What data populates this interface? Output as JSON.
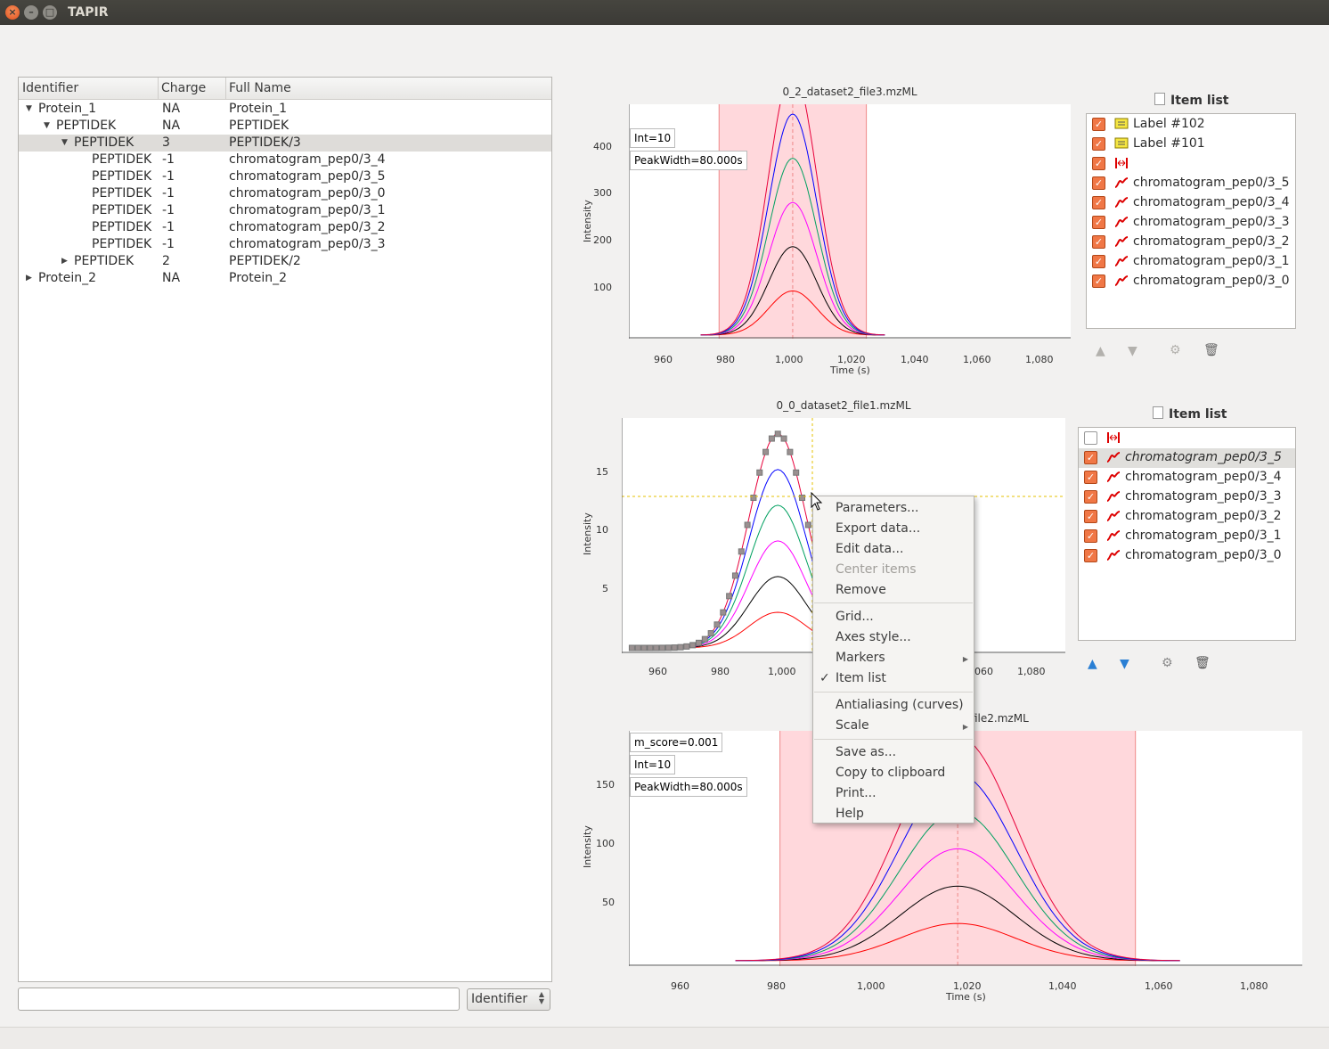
{
  "window": {
    "title": "TAPIR"
  },
  "tree": {
    "columns": [
      "Identifier",
      "Charge",
      "Full Name"
    ],
    "rows": [
      {
        "id": "Protein_1",
        "charge": "NA",
        "name": "Protein_1"
      },
      {
        "id": "PEPTIDEK",
        "charge": "NA",
        "name": "PEPTIDEK"
      },
      {
        "id": "PEPTIDEK",
        "charge": "3",
        "name": "PEPTIDEK/3"
      },
      {
        "id": "PEPTIDEK",
        "charge": "-1",
        "name": "chromatogram_pep0/3_4"
      },
      {
        "id": "PEPTIDEK",
        "charge": "-1",
        "name": "chromatogram_pep0/3_5"
      },
      {
        "id": "PEPTIDEK",
        "charge": "-1",
        "name": "chromatogram_pep0/3_0"
      },
      {
        "id": "PEPTIDEK",
        "charge": "-1",
        "name": "chromatogram_pep0/3_1"
      },
      {
        "id": "PEPTIDEK",
        "charge": "-1",
        "name": "chromatogram_pep0/3_2"
      },
      {
        "id": "PEPTIDEK",
        "charge": "-1",
        "name": "chromatogram_pep0/3_3"
      },
      {
        "id": "PEPTIDEK",
        "charge": "2",
        "name": "PEPTIDEK/2"
      },
      {
        "id": "Protein_2",
        "charge": "NA",
        "name": "Protein_2"
      }
    ]
  },
  "search": {
    "value": "",
    "field": "Identifier"
  },
  "plots": [
    {
      "title": "0_2_dataset2_file3.mzML",
      "xlabel": "Time (s)",
      "ylabel": "Intensity",
      "xticks": [
        "960",
        "980",
        "1,000",
        "1,020",
        "1,040",
        "1,060",
        "1,080"
      ],
      "yticks": [
        "100",
        "200",
        "300",
        "400"
      ],
      "labels": [
        "Int=10",
        "PeakWidth=80.000s"
      ]
    },
    {
      "title": "0_0_dataset2_file1.mzML",
      "xlabel": "",
      "ylabel": "Intensity",
      "xticks": [
        "960",
        "980",
        "1,000",
        "060",
        "1,080"
      ],
      "yticks": [
        "5",
        "10",
        "15"
      ],
      "labels": []
    },
    {
      "title": "file2.mzML",
      "xlabel": "Time (s)",
      "ylabel": "Intensity",
      "xticks": [
        "960",
        "980",
        "1,000",
        "1,020",
        "1,040",
        "1,060",
        "1,080"
      ],
      "yticks": [
        "50",
        "100",
        "150"
      ],
      "labels": [
        "m_score=0.001",
        "Int=10",
        "PeakWidth=80.000s"
      ]
    }
  ],
  "item_lists": [
    {
      "header": "Item list",
      "items": [
        {
          "label": "Label #102",
          "icon": "label-icon",
          "checked": true
        },
        {
          "label": "Label #101",
          "icon": "label-icon",
          "checked": true
        },
        {
          "label": "",
          "icon": "range-icon",
          "checked": true
        },
        {
          "label": "chromatogram_pep0/3_5",
          "icon": "curve-icon",
          "checked": true
        },
        {
          "label": "chromatogram_pep0/3_4",
          "icon": "curve-icon",
          "checked": true
        },
        {
          "label": "chromatogram_pep0/3_3",
          "icon": "curve-icon",
          "checked": true
        },
        {
          "label": "chromatogram_pep0/3_2",
          "icon": "curve-icon",
          "checked": true
        },
        {
          "label": "chromatogram_pep0/3_1",
          "icon": "curve-icon",
          "checked": true
        },
        {
          "label": "chromatogram_pep0/3_0",
          "icon": "curve-icon",
          "checked": true
        }
      ]
    },
    {
      "header": "Item list",
      "items": [
        {
          "label": "",
          "icon": "range-icon",
          "checked": false
        },
        {
          "label": "chromatogram_pep0/3_5",
          "icon": "curve-icon",
          "checked": true
        },
        {
          "label": "chromatogram_pep0/3_4",
          "icon": "curve-icon",
          "checked": true
        },
        {
          "label": "chromatogram_pep0/3_3",
          "icon": "curve-icon",
          "checked": true
        },
        {
          "label": "chromatogram_pep0/3_2",
          "icon": "curve-icon",
          "checked": true
        },
        {
          "label": "chromatogram_pep0/3_1",
          "icon": "curve-icon",
          "checked": true
        },
        {
          "label": "chromatogram_pep0/3_0",
          "icon": "curve-icon",
          "checked": true
        }
      ]
    }
  ],
  "context_menu": {
    "items": [
      {
        "label": "Parameters..."
      },
      {
        "label": "Export data..."
      },
      {
        "label": "Edit data..."
      },
      {
        "label": "Center items",
        "disabled": true
      },
      {
        "label": "Remove"
      },
      {
        "label": "Grid..."
      },
      {
        "label": "Axes style..."
      },
      {
        "label": "Markers",
        "submenu": true
      },
      {
        "label": "Item list",
        "checked": true
      },
      {
        "label": "Antialiasing (curves)"
      },
      {
        "label": "Scale",
        "submenu": true
      },
      {
        "label": "Save as..."
      },
      {
        "label": "Copy to clipboard"
      },
      {
        "label": "Print..."
      },
      {
        "label": "Help"
      }
    ]
  },
  "colors": {
    "curves": [
      "#ff0000",
      "#000000",
      "#ff00ff",
      "#00a060",
      "#0000ff",
      "#e8003a"
    ],
    "selection_fill": "#ffd8dc",
    "checkbox": "#f07746"
  }
}
